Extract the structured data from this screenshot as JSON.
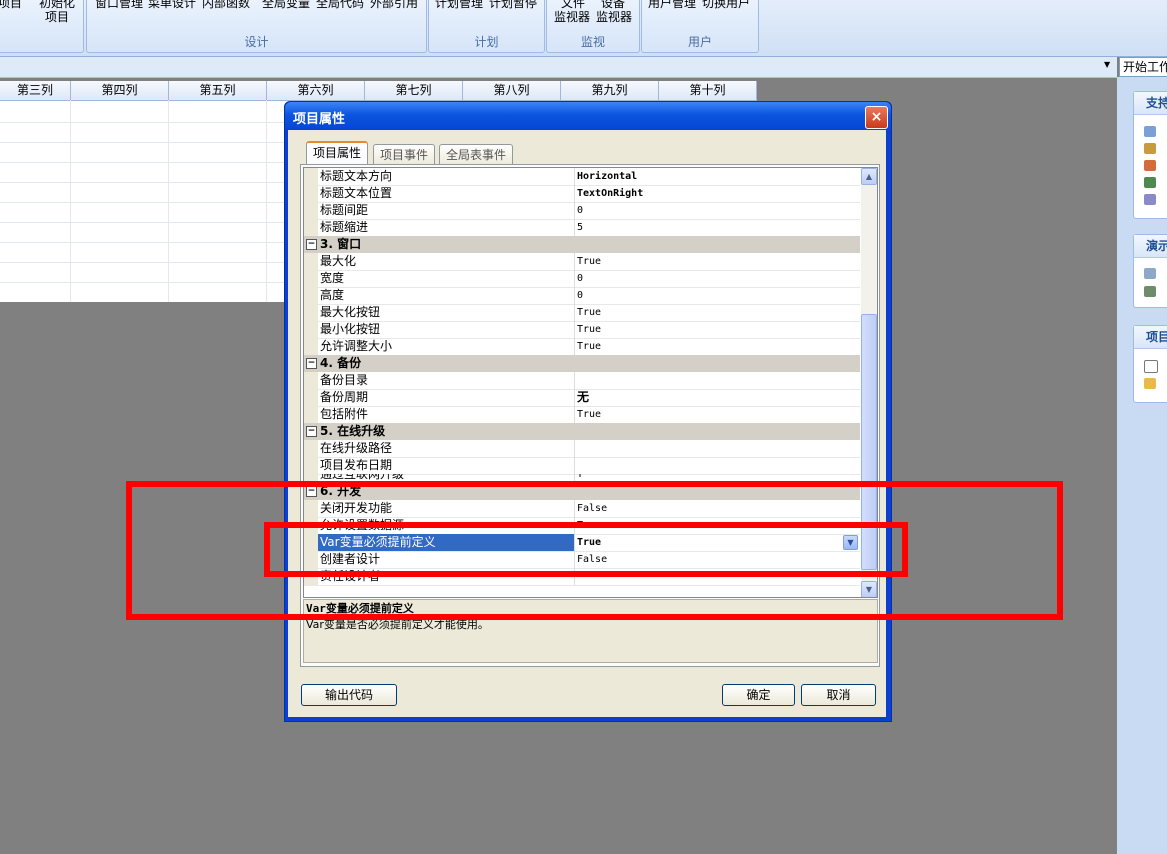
{
  "ribbon": {
    "groups": [
      {
        "label": ""
      },
      {
        "label": "设计"
      },
      {
        "label": "计划"
      },
      {
        "label": "监视"
      },
      {
        "label": "用户"
      }
    ],
    "buttons": {
      "b0": "项目",
      "b1": "初始化",
      "b1b": "项目",
      "b2": "窗口管理",
      "b3": "菜单设计",
      "b4": "内部函数",
      "b5": "全局变量",
      "b6": "全局代码",
      "b7": "外部引用",
      "b8": "计划管理",
      "b9": "计划暂停",
      "b10": "文件",
      "b10b": "监视器",
      "b11": "设备",
      "b11b": "监视器",
      "b12": "用户管理",
      "b13": "切换用户"
    }
  },
  "workspace": {
    "selected": "开始工作"
  },
  "grid": {
    "columns": [
      "第三列",
      "第四列",
      "第五列",
      "第六列",
      "第七列",
      "第八列",
      "第九列",
      "第十列"
    ]
  },
  "right_panel": {
    "sections": [
      {
        "title": "支持"
      },
      {
        "title": "演示"
      },
      {
        "title": "项目"
      }
    ]
  },
  "dialog": {
    "title": "项目属性",
    "close": "×",
    "tabs": [
      "项目属性",
      "项目事件",
      "全局表事件"
    ],
    "categories": {
      "c3": "3. 窗口",
      "c4": "4. 备份",
      "c5": "5. 在线升级",
      "c6": "6. 开发"
    },
    "rows": {
      "r0": {
        "name": "标题文本方向",
        "value": "Horizontal"
      },
      "r1": {
        "name": "标题文本位置",
        "value": "TextOnRight"
      },
      "r2": {
        "name": "标题间距",
        "value": "0"
      },
      "r3": {
        "name": "标题缩进",
        "value": "5"
      },
      "r4": {
        "name": "最大化",
        "value": "True"
      },
      "r5": {
        "name": "宽度",
        "value": "0"
      },
      "r6": {
        "name": "高度",
        "value": "0"
      },
      "r7": {
        "name": "最大化按钮",
        "value": "True"
      },
      "r8": {
        "name": "最小化按钮",
        "value": "True"
      },
      "r9": {
        "name": "允许调整大小",
        "value": "True"
      },
      "r10": {
        "name": "备份目录",
        "value": ""
      },
      "r11": {
        "name": "备份周期",
        "value": "无"
      },
      "r12": {
        "name": "包括附件",
        "value": "True"
      },
      "r13": {
        "name": "在线升级路径",
        "value": ""
      },
      "r14": {
        "name": "项目发布日期",
        "value": ""
      },
      "r15": {
        "name": "通过互联网升级",
        "value": "T"
      },
      "r16": {
        "name": "关闭开发功能",
        "value": "False"
      },
      "r17": {
        "name": "允许设置数据源",
        "value": "True"
      },
      "r18": {
        "name": "Var变量必须提前定义",
        "value": "True"
      },
      "r19": {
        "name": "创建者设计",
        "value": "False"
      },
      "r20": {
        "name": "责任设计者",
        "value": ""
      }
    },
    "description": {
      "title": "Var变量必须提前定义",
      "text": "Var变量是否必须提前定义才能使用。"
    },
    "buttons": {
      "export": "输出代码",
      "ok": "确定",
      "cancel": "取消"
    }
  },
  "colors": {
    "annotation": "#ff0000",
    "selection": "#316ac5"
  }
}
